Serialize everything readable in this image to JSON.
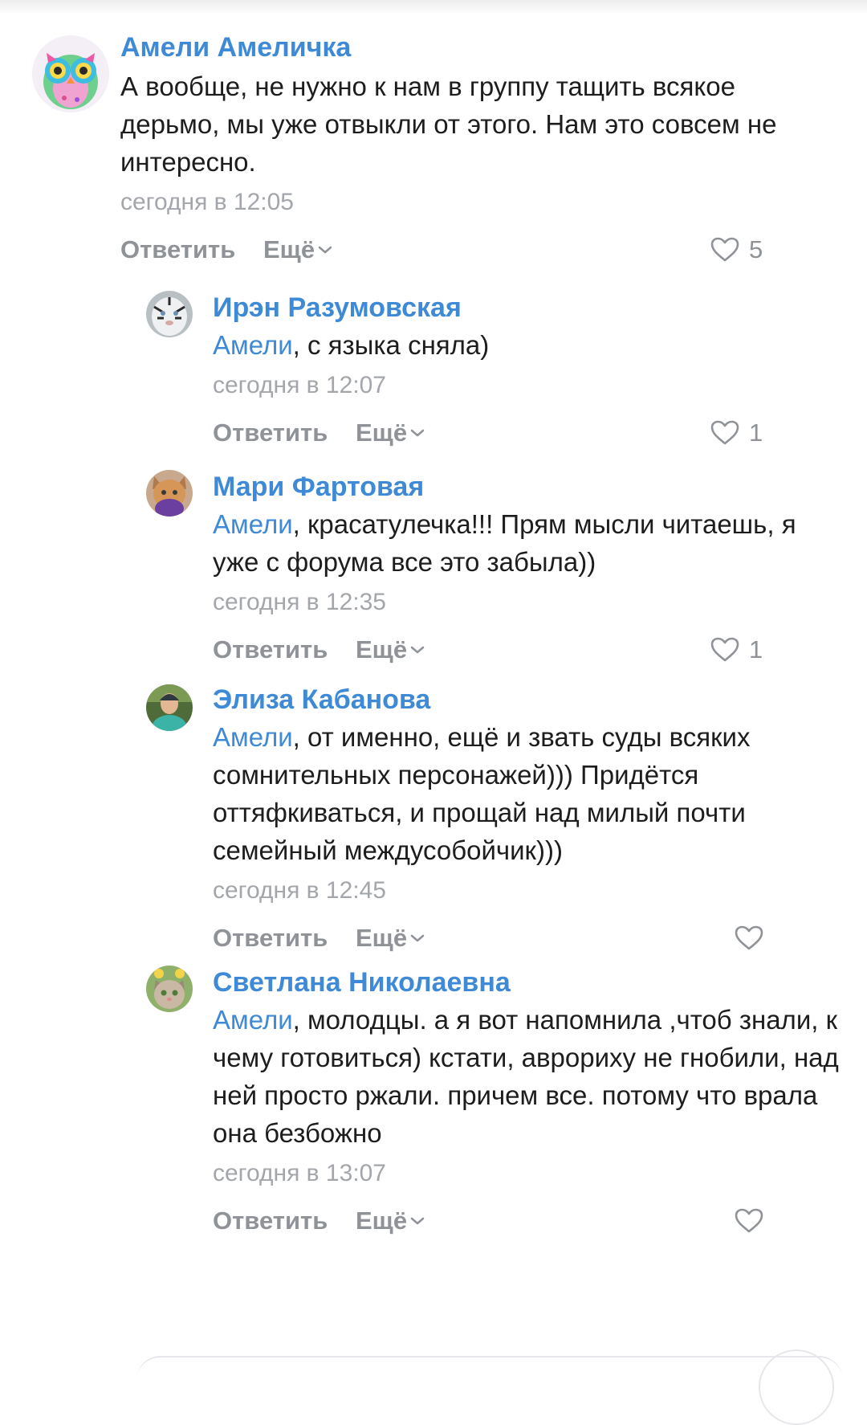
{
  "actions": {
    "reply_label": "Ответить",
    "more_label": "Ещё"
  },
  "comments": [
    {
      "author": "Амели Амеличка",
      "mention": "",
      "text": "А вообще, не нужно к нам в группу тащить всякое дерьмо, мы уже отвыкли от этого. Нам это совсем не интересно.",
      "time": "сегодня в 12:05",
      "likes": "5",
      "avatar_icon": "owl-avatar"
    },
    {
      "author": "Ирэн Разумовская",
      "mention": "Амели",
      "text": ", с языка сняла)",
      "time": "сегодня в 12:07",
      "likes": "1",
      "avatar_icon": "tiger-avatar"
    },
    {
      "author": "Мари Фартовая",
      "mention": "Амели",
      "text": ", красатулечка!!! Прям мысли читаешь, я уже с форума все это забыла))",
      "time": "сегодня в 12:35",
      "likes": "1",
      "avatar_icon": "cat-avatar"
    },
    {
      "author": "Элиза Кабанова",
      "mention": "Амели",
      "text": ", от именно, ещё и звать суды всяких сомнительных персонажей))) Придётся оттяфкиваться, и прощай над милый почти семейный междусобойчик)))",
      "time": "сегодня в 12:45",
      "likes": "",
      "avatar_icon": "person-avatar"
    },
    {
      "author": "Светлана Николаевна",
      "mention": "Амели",
      "text": ", молодцы. а я вот напомнила ,чтоб знали, к чему готовиться) кстати, аврориху не гнобили, над ней просто ржали. причем все. потому что врала она безбожно",
      "time": "сегодня в 13:07",
      "likes": "",
      "avatar_icon": "kitten-avatar"
    }
  ],
  "colors": {
    "link": "#3f8ad6",
    "meta": "#a3a6ab",
    "action": "#8f9398",
    "text": "#1d1d1d"
  }
}
